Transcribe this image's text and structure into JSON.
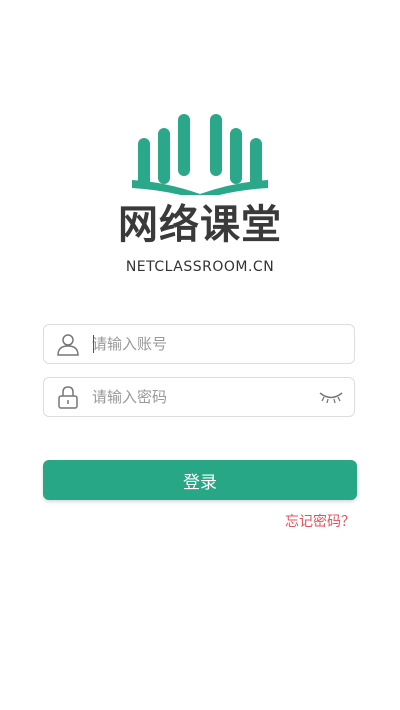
{
  "brand": {
    "logo_icon": "open-book-icon",
    "name": "网络课堂",
    "domain": "NETCLASSROOM.CN",
    "color": "#2aa889"
  },
  "login_form": {
    "account": {
      "icon": "user-icon",
      "placeholder": "请输入账号",
      "value": ""
    },
    "password": {
      "icon": "lock-icon",
      "placeholder": "请输入密码",
      "value": "",
      "toggle_icon": "eye-closed-icon"
    },
    "submit_label": "登录",
    "submit_color": "#27a786",
    "forgot_label": "忘记密码？",
    "forgot_color": "#e8505b"
  }
}
